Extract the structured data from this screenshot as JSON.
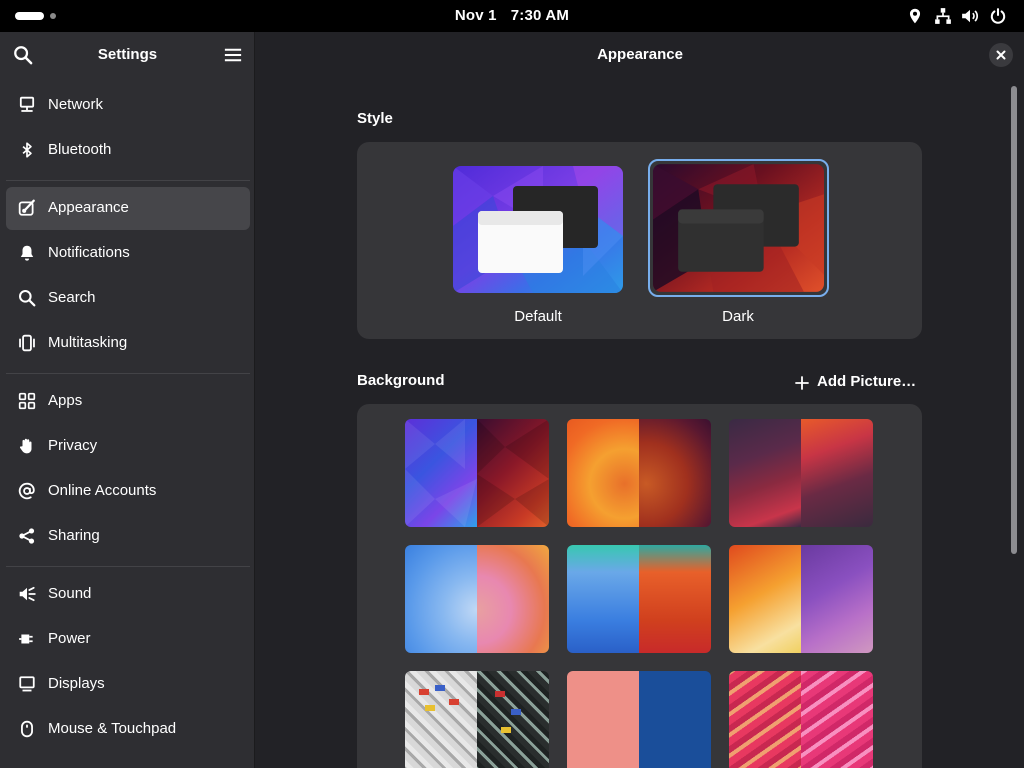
{
  "topbar": {
    "date": "Nov 1",
    "time": "7:30 AM",
    "icons": [
      "location-icon",
      "network-wired-icon",
      "volume-icon",
      "power-icon"
    ]
  },
  "sidebar": {
    "title": "Settings",
    "items": [
      {
        "label": "Network",
        "icon": "network-icon"
      },
      {
        "label": "Bluetooth",
        "icon": "bluetooth-icon"
      },
      {
        "label": "Appearance",
        "icon": "appearance-icon",
        "active": true
      },
      {
        "label": "Notifications",
        "icon": "bell-icon"
      },
      {
        "label": "Search",
        "icon": "search-icon"
      },
      {
        "label": "Multitasking",
        "icon": "multitasking-icon"
      },
      {
        "label": "Apps",
        "icon": "apps-grid-icon"
      },
      {
        "label": "Privacy",
        "icon": "hand-icon"
      },
      {
        "label": "Online Accounts",
        "icon": "at-sign-icon"
      },
      {
        "label": "Sharing",
        "icon": "share-icon"
      },
      {
        "label": "Sound",
        "icon": "speaker-icon"
      },
      {
        "label": "Power",
        "icon": "power-plug-icon"
      },
      {
        "label": "Displays",
        "icon": "display-icon"
      },
      {
        "label": "Mouse & Touchpad",
        "icon": "mouse-icon"
      }
    ]
  },
  "content": {
    "title": "Appearance",
    "style": {
      "heading": "Style",
      "options": [
        {
          "label": "Default",
          "selected": false
        },
        {
          "label": "Dark",
          "selected": true
        }
      ]
    },
    "background": {
      "heading": "Background",
      "add_label": "Add Picture…"
    }
  },
  "colors": {
    "accent": "#78aeed",
    "sidebar_bg": "#2e2e32",
    "content_bg": "#222226",
    "card_bg": "#363639"
  }
}
